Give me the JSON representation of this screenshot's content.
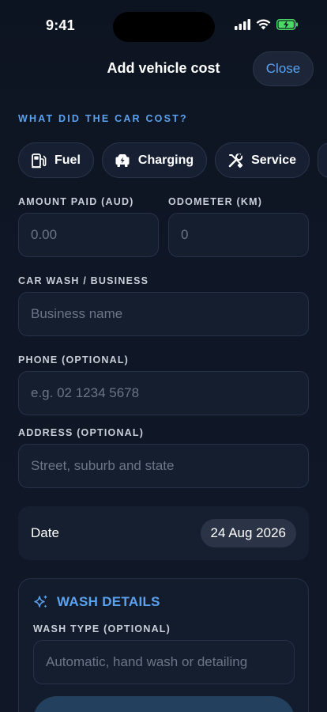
{
  "status": {
    "time": "9:41"
  },
  "nav": {
    "title": "Add vehicle cost",
    "close_label": "Close"
  },
  "section_label": "WHAT DID THE CAR COST?",
  "categories": [
    {
      "label": "Fuel",
      "icon": "fuel-pump-icon"
    },
    {
      "label": "Charging",
      "icon": "ev-charging-icon"
    },
    {
      "label": "Service",
      "icon": "wrench-tools-icon"
    }
  ],
  "fields": {
    "amount": {
      "label": "AMOUNT PAID (AUD)",
      "placeholder": "0.00"
    },
    "odometer": {
      "label": "ODOMETER (KM)",
      "placeholder": "0"
    },
    "business": {
      "label": "CAR WASH / BUSINESS",
      "placeholder": "Business name"
    },
    "phone": {
      "label": "PHONE (OPTIONAL)",
      "placeholder": "e.g. 02 1234 5678"
    },
    "address": {
      "label": "ADDRESS (OPTIONAL)",
      "placeholder": "Street, suburb and state"
    }
  },
  "date": {
    "label": "Date",
    "value": "24 Aug 2026"
  },
  "wash": {
    "title": "WASH DETAILS",
    "icon": "sparkles-icon",
    "type_label": "WASH TYPE (OPTIONAL)",
    "type_placeholder": "Automatic, hand wash or detailing"
  },
  "colors": {
    "accent": "#5aa2f0",
    "background": "#0f1726",
    "battery": "#4cd964"
  }
}
